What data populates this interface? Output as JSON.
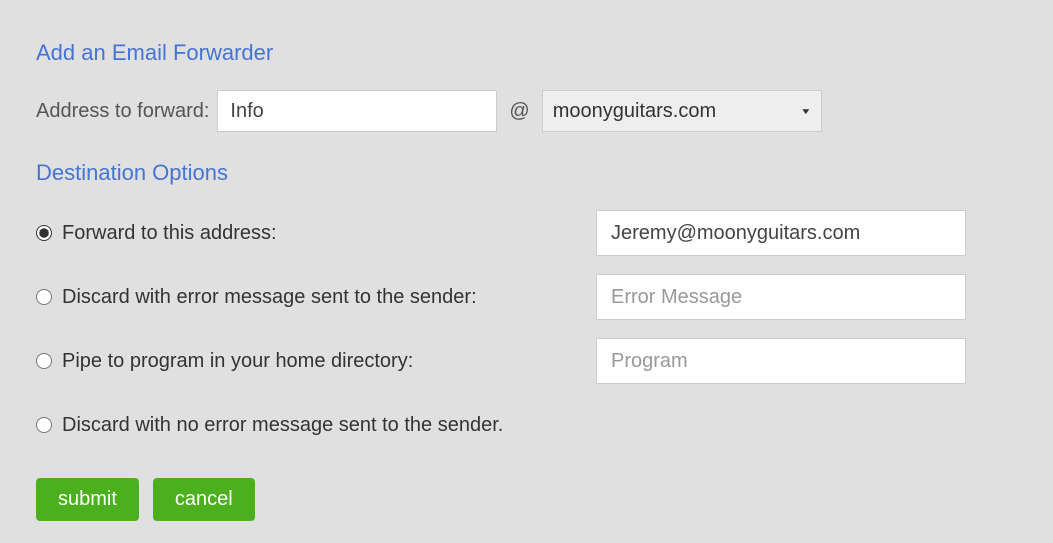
{
  "sections": {
    "add_forwarder_title": "Add an Email Forwarder",
    "destination_title": "Destination Options"
  },
  "address": {
    "label": "Address to forward:",
    "value": "Info",
    "at": "@",
    "domain_selected": "moonyguitars.com"
  },
  "options": {
    "forward": {
      "label": "Forward to this address:",
      "value": "Jeremy@moonyguitars.com"
    },
    "discard_error": {
      "label": "Discard with error message sent to the sender:",
      "placeholder": "Error Message"
    },
    "pipe": {
      "label": "Pipe to program in your home directory:",
      "placeholder": "Program"
    },
    "discard_silent": {
      "label": "Discard with no error message sent to the sender."
    }
  },
  "buttons": {
    "submit": "submit",
    "cancel": "cancel"
  }
}
